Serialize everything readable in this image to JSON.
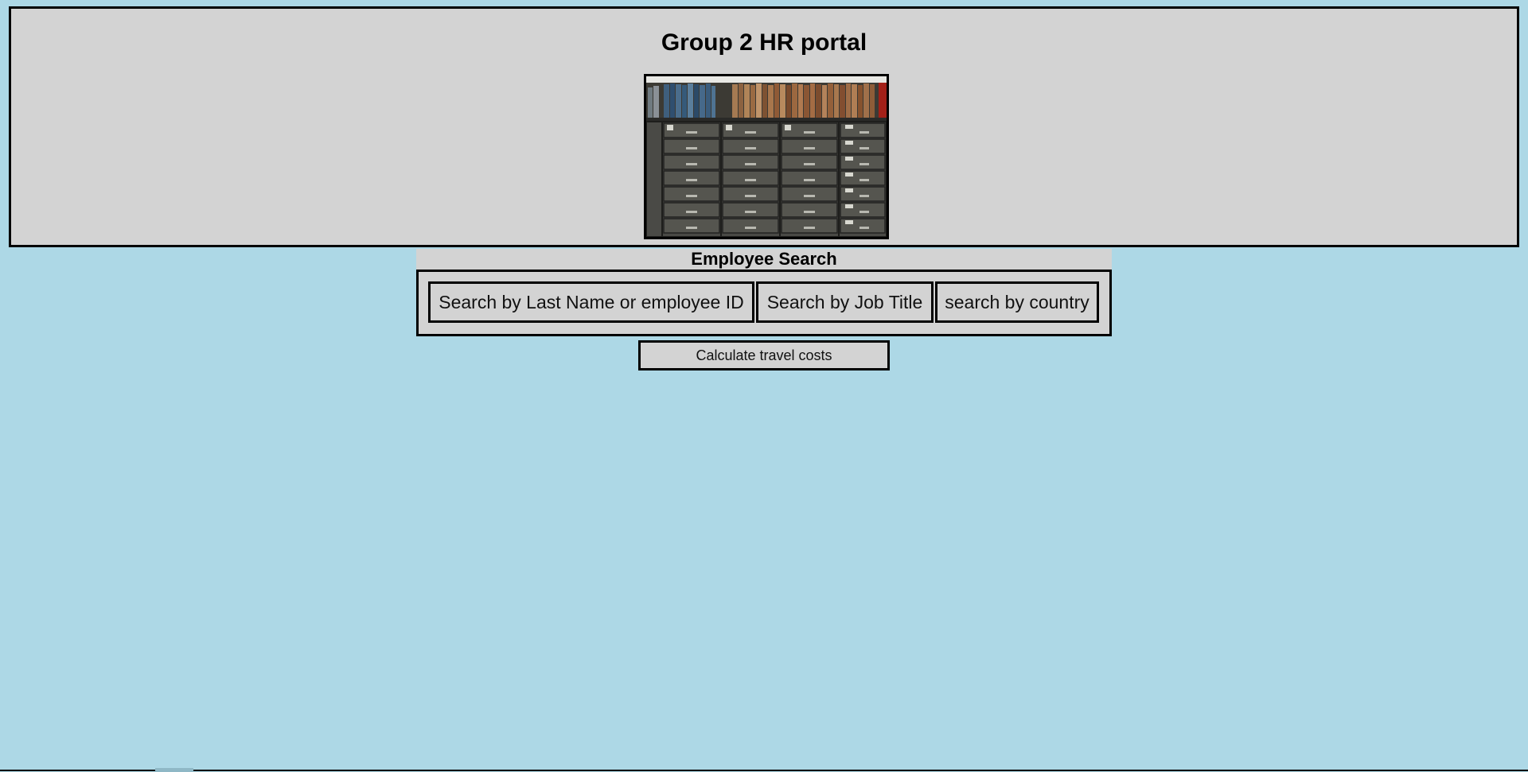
{
  "header": {
    "title": "Group 2 HR portal",
    "image_icon": "filing-cabinets-photo"
  },
  "employee_search": {
    "heading": "Employee Search",
    "buttons": [
      {
        "label": "Search by Last Name or employee ID"
      },
      {
        "label": "Search by Job Title"
      },
      {
        "label": "search by country"
      }
    ]
  },
  "travel": {
    "button_label": "Calculate travel costs"
  },
  "colors": {
    "page_background": "#add8e6",
    "panel_background": "#d3d3d3",
    "border": "#000000"
  }
}
